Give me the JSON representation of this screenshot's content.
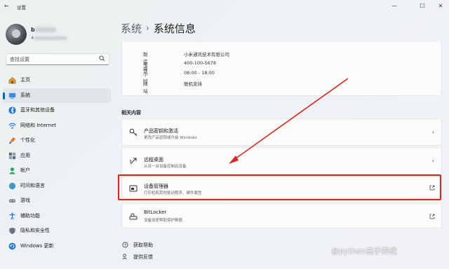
{
  "window": {
    "title": "设置"
  },
  "user": {
    "name": "b",
    "id": "4"
  },
  "search": {
    "placeholder": "查找设置"
  },
  "nav": [
    {
      "label": "主页",
      "icon": "home-icon"
    },
    {
      "label": "系统",
      "icon": "system-icon",
      "selected": true
    },
    {
      "label": "蓝牙和其他设备",
      "icon": "bluetooth-icon"
    },
    {
      "label": "网络和 Internet",
      "icon": "wifi-icon"
    },
    {
      "label": "个性化",
      "icon": "brush-icon"
    },
    {
      "label": "应用",
      "icon": "apps-icon"
    },
    {
      "label": "帐户",
      "icon": "account-icon"
    },
    {
      "label": "时间和语言",
      "icon": "globe-icon"
    },
    {
      "label": "游戏",
      "icon": "gamepad-icon"
    },
    {
      "label": "辅助功能",
      "icon": "accessibility-icon"
    },
    {
      "label": "隐私和安全性",
      "icon": "shield-icon"
    },
    {
      "label": "Windows 更新",
      "icon": "update-icon"
    }
  ],
  "header": {
    "crumb": "系统",
    "separator": "›",
    "title": "系统信息"
  },
  "support_info": [
    {
      "key": "制造商",
      "value": "小米通讯技术有限公司"
    },
    {
      "key": "电话",
      "value": "400-100-5678"
    },
    {
      "key": "小时",
      "value": "08:00 - 18:00"
    },
    {
      "key": "网站",
      "value": "联机支持"
    }
  ],
  "related": {
    "heading": "相关内容",
    "items": [
      {
        "title": "产品密钥和激活",
        "subtitle": "更改产品密钥或升级 Windows",
        "icon": "key-icon",
        "action": "chevron"
      },
      {
        "title": "远程桌面",
        "subtitle": "从另一台设备控制此设备",
        "icon": "remote-desktop-icon",
        "action": "chevron"
      },
      {
        "title": "设备管理器",
        "subtitle": "打印机和其他驱动程序、硬件属性",
        "icon": "device-manager-icon",
        "action": "external",
        "highlighted": true
      },
      {
        "title": "BitLocker",
        "subtitle": "设备加密帮助保护数据",
        "icon": "bitlocker-icon",
        "action": "external"
      }
    ]
  },
  "links": [
    {
      "label": "获取帮助",
      "icon": "help-icon"
    },
    {
      "label": "提供反馈",
      "icon": "feedback-icon"
    }
  ],
  "watermark": "@python高手养成",
  "colors": {
    "accent": "#0067c0",
    "highlight": "#e2231a"
  }
}
